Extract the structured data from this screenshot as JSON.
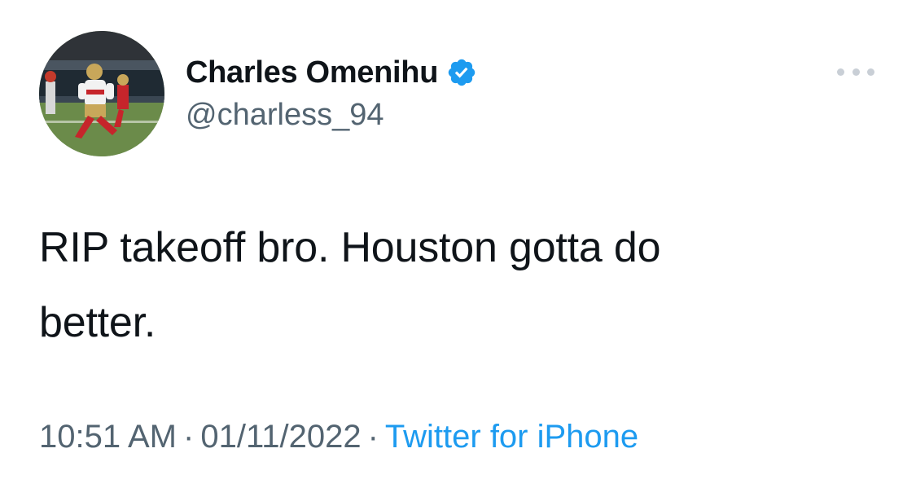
{
  "tweet": {
    "author": {
      "display_name": "Charles Omenihu",
      "handle": "@charless_94",
      "verified": true,
      "avatar_icon": "football-player-avatar"
    },
    "more_icon": "ellipsis-icon",
    "text_line1": "RIP takeoff bro. Houston gotta do",
    "text_line2": "better.",
    "time": "10:51 AM",
    "date": "01/11/2022",
    "separator": "·",
    "source": "Twitter for iPhone"
  },
  "colors": {
    "text_primary": "#0f1419",
    "text_secondary": "#536471",
    "link": "#1d9bf0",
    "verified_badge": "#1d9bf0"
  }
}
